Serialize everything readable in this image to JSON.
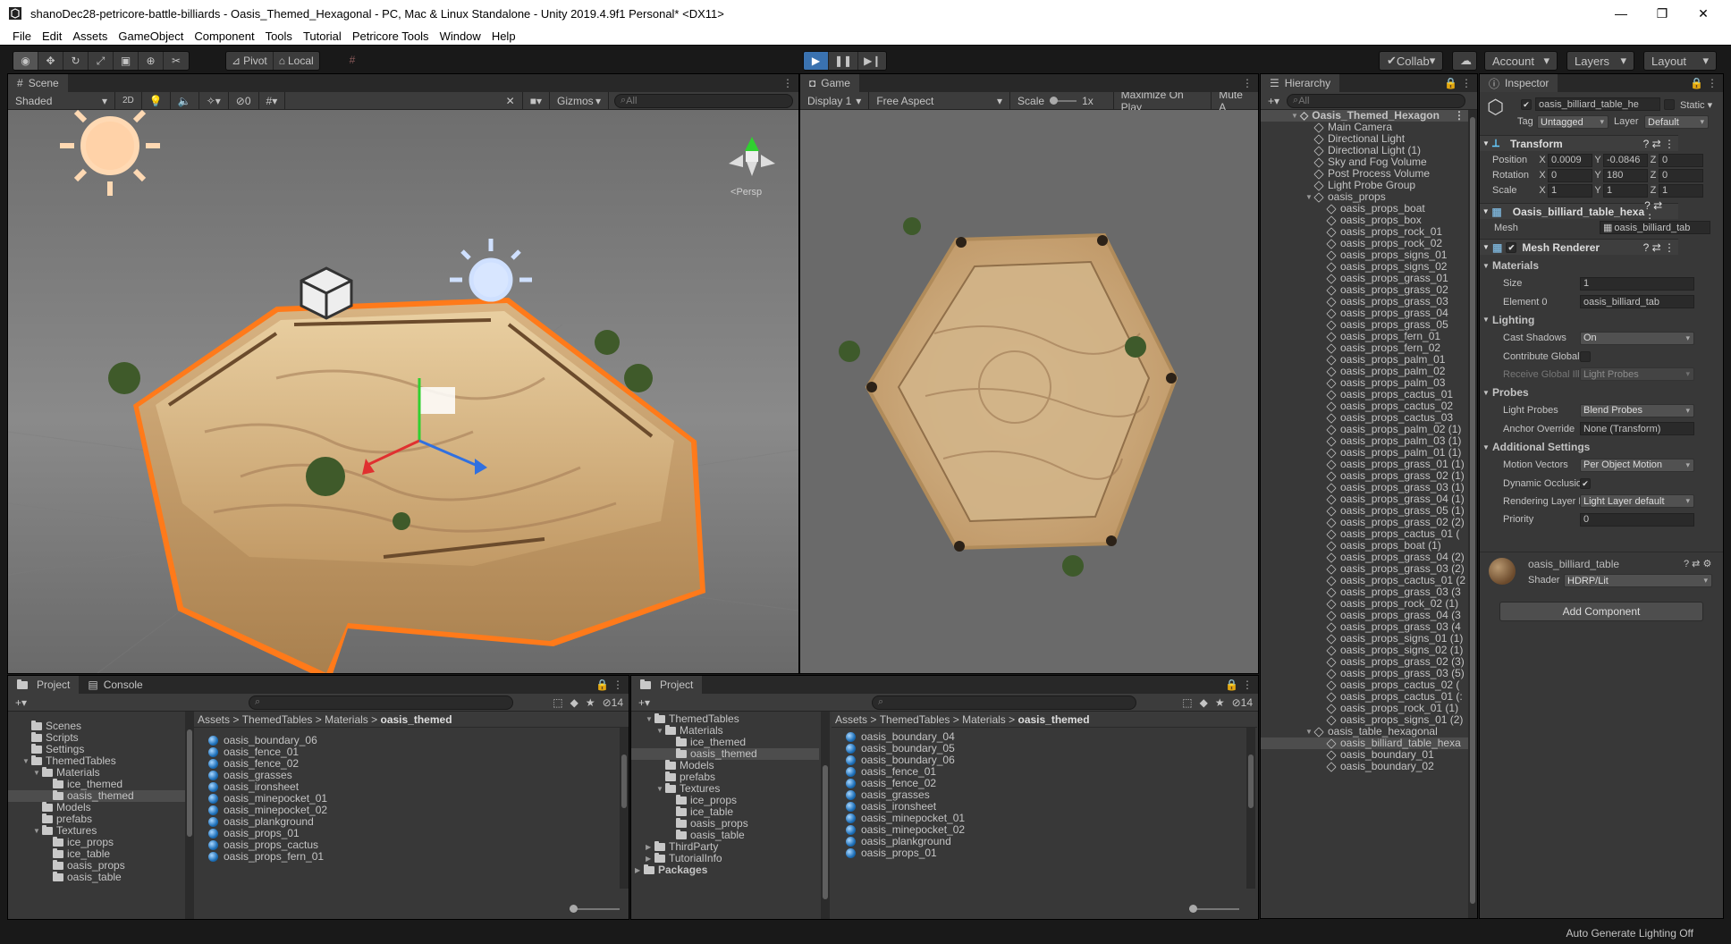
{
  "title": {
    "text": "shanoDec28-petricore-battle-billiards - Oasis_Themed_Hexagonal - PC, Mac & Linux Standalone - Unity 2019.4.9f1 Personal* <DX11>"
  },
  "menu": [
    "File",
    "Edit",
    "Assets",
    "GameObject",
    "Component",
    "Tools",
    "Tutorial",
    "Petricore Tools",
    "Window",
    "Help"
  ],
  "toolbar": {
    "pivot": "Pivot",
    "local": "Local",
    "collab": "Collab",
    "account": "Account",
    "layers": "Layers",
    "layout": "Layout"
  },
  "scene": {
    "tab": "Scene",
    "shading": "Shaded",
    "mode2d": "2D",
    "hidden_count": "0",
    "gizmos": "Gizmos",
    "search_placeholder": "All",
    "persp": "Persp",
    "persp_prefix": "<"
  },
  "game": {
    "tab": "Game",
    "display": "Display 1",
    "aspect": "Free Aspect",
    "scale_label": "Scale",
    "scale_value": "1x",
    "maximize": "Maximize On Play",
    "mute": "Mute A"
  },
  "hierarchy": {
    "tab": "Hierarchy",
    "search_placeholder": "All",
    "root": "Oasis_Themed_Hexagon",
    "items": [
      "Main Camera",
      "Directional Light",
      "Directional Light (1)",
      "Sky and Fog Volume",
      "Post Process Volume",
      "Light Probe Group",
      "oasis_props"
    ],
    "props": [
      "oasis_props_boat",
      "oasis_props_box",
      "oasis_props_rock_01",
      "oasis_props_rock_02",
      "oasis_props_signs_01",
      "oasis_props_signs_02",
      "oasis_props_grass_01",
      "oasis_props_grass_02",
      "oasis_props_grass_03",
      "oasis_props_grass_04",
      "oasis_props_grass_05",
      "oasis_props_fern_01",
      "oasis_props_fern_02",
      "oasis_props_palm_01",
      "oasis_props_palm_02",
      "oasis_props_palm_03",
      "oasis_props_cactus_01",
      "oasis_props_cactus_02",
      "oasis_props_cactus_03",
      "oasis_props_palm_02 (1)",
      "oasis_props_palm_03 (1)",
      "oasis_props_palm_01 (1)",
      "oasis_props_grass_01 (1)",
      "oasis_props_grass_02 (1)",
      "oasis_props_grass_03 (1)",
      "oasis_props_grass_04 (1)",
      "oasis_props_grass_05 (1)",
      "oasis_props_grass_02 (2)",
      "oasis_props_cactus_01 (",
      "oasis_props_boat (1)",
      "oasis_props_grass_04 (2)",
      "oasis_props_grass_03 (2)",
      "oasis_props_cactus_01 (2",
      "oasis_props_grass_03 (3",
      "oasis_props_rock_02 (1)",
      "oasis_props_grass_04 (3",
      "oasis_props_grass_03 (4",
      "oasis_props_signs_01 (1)",
      "oasis_props_signs_02 (1)",
      "oasis_props_grass_02 (3)",
      "oasis_props_grass_03 (5)",
      "oasis_props_cactus_02 (",
      "oasis_props_cactus_01 (:",
      "oasis_props_rock_01 (1)",
      "oasis_props_signs_01 (2)"
    ],
    "table_group": "oasis_table_hexagonal",
    "table_items": [
      "oasis_billiard_table_hexa",
      "oasis_boundary_01",
      "oasis_boundary_02"
    ]
  },
  "inspector": {
    "tab": "Inspector",
    "object_name": "oasis_billiard_table_he",
    "static": "Static",
    "tag_label": "Tag",
    "tag": "Untagged",
    "layer_label": "Layer",
    "layer": "Default",
    "transform": {
      "title": "Transform",
      "pos_label": "Position",
      "rot_label": "Rotation",
      "scale_label": "Scale",
      "px": "0.0009",
      "py": "-0.0846",
      "pz": "0",
      "rx": "0",
      "ry": "180",
      "rz": "0",
      "sx": "1",
      "sy": "1",
      "sz": "1"
    },
    "meshfilter": {
      "title": "Oasis_billiard_table_hexa",
      "mesh_label": "Mesh",
      "mesh": "oasis_billiard_tab"
    },
    "renderer": {
      "title": "Mesh Renderer",
      "materials": "Materials",
      "size_label": "Size",
      "size": "1",
      "el0_label": "Element 0",
      "el0": "oasis_billiard_tab",
      "lighting": "Lighting",
      "cast_label": "Cast Shadows",
      "cast": "On",
      "contrib_label": "Contribute Global I",
      "receive_label": "Receive Global Illu",
      "receive": "Light Probes",
      "probes": "Probes",
      "lp_label": "Light Probes",
      "lp": "Blend Probes",
      "anchor_label": "Anchor Override",
      "anchor": "None (Transform)",
      "additional": "Additional Settings",
      "mv_label": "Motion Vectors",
      "mv": "Per Object Motion",
      "dyn_label": "Dynamic Occlusio",
      "rl_label": "Rendering Layer M",
      "rl": "Light Layer default",
      "prio_label": "Priority",
      "prio": "0"
    },
    "material": {
      "name": "oasis_billiard_table",
      "shader_label": "Shader",
      "shader": "HDRP/Lit"
    },
    "add_component": "Add Component",
    "xyz": [
      "X",
      "Y",
      "Z"
    ]
  },
  "project_left": {
    "tab": "Project",
    "console_tab": "Console",
    "count": "14",
    "crumbs": [
      "Assets",
      "ThemedTables",
      "Materials"
    ],
    "crumb_last": "oasis_themed",
    "tree": [
      {
        "label": "Scenes",
        "indent": 1,
        "fold": ""
      },
      {
        "label": "Scripts",
        "indent": 1,
        "fold": ""
      },
      {
        "label": "Settings",
        "indent": 1,
        "fold": ""
      },
      {
        "label": "ThemedTables",
        "indent": 1,
        "fold": "▼"
      },
      {
        "label": "Materials",
        "indent": 2,
        "fold": "▼"
      },
      {
        "label": "ice_themed",
        "indent": 3,
        "fold": ""
      },
      {
        "label": "oasis_themed",
        "indent": 3,
        "fold": "",
        "sel": true
      },
      {
        "label": "Models",
        "indent": 2,
        "fold": ""
      },
      {
        "label": "prefabs",
        "indent": 2,
        "fold": ""
      },
      {
        "label": "Textures",
        "indent": 2,
        "fold": "▼"
      },
      {
        "label": "ice_props",
        "indent": 3,
        "fold": ""
      },
      {
        "label": "ice_table",
        "indent": 3,
        "fold": ""
      },
      {
        "label": "oasis_props",
        "indent": 3,
        "fold": ""
      },
      {
        "label": "oasis_table",
        "indent": 3,
        "fold": ""
      }
    ],
    "files": [
      "oasis_boundary_06",
      "oasis_fence_01",
      "oasis_fence_02",
      "oasis_grasses",
      "oasis_ironsheet",
      "oasis_minepocket_01",
      "oasis_minepocket_02",
      "oasis_plankground",
      "oasis_props_01",
      "oasis_props_cactus",
      "oasis_props_fern_01"
    ]
  },
  "project_right": {
    "tab": "Project",
    "count": "14",
    "crumbs": [
      "Assets",
      "ThemedTables",
      "Materials"
    ],
    "crumb_last": "oasis_themed",
    "tree": [
      {
        "label": "ThemedTables",
        "indent": 1,
        "fold": "▼"
      },
      {
        "label": "Materials",
        "indent": 2,
        "fold": "▼"
      },
      {
        "label": "ice_themed",
        "indent": 3,
        "fold": ""
      },
      {
        "label": "oasis_themed",
        "indent": 3,
        "fold": "",
        "sel": true
      },
      {
        "label": "Models",
        "indent": 2,
        "fold": ""
      },
      {
        "label": "prefabs",
        "indent": 2,
        "fold": ""
      },
      {
        "label": "Textures",
        "indent": 2,
        "fold": "▼"
      },
      {
        "label": "ice_props",
        "indent": 3,
        "fold": ""
      },
      {
        "label": "ice_table",
        "indent": 3,
        "fold": ""
      },
      {
        "label": "oasis_props",
        "indent": 3,
        "fold": ""
      },
      {
        "label": "oasis_table",
        "indent": 3,
        "fold": ""
      },
      {
        "label": "ThirdParty",
        "indent": 1,
        "fold": "▶"
      },
      {
        "label": "TutorialInfo",
        "indent": 1,
        "fold": "▶"
      },
      {
        "label": "Packages",
        "indent": 0,
        "fold": "▶",
        "bold": true
      }
    ],
    "files": [
      "oasis_boundary_04",
      "oasis_boundary_05",
      "oasis_boundary_06",
      "oasis_fence_01",
      "oasis_fence_02",
      "oasis_grasses",
      "oasis_ironsheet",
      "oasis_minepocket_01",
      "oasis_minepocket_02",
      "oasis_plankground",
      "oasis_props_01"
    ]
  },
  "status": {
    "lighting": "Auto Generate Lighting Off"
  },
  "colors": {
    "accent": "#2c5d87",
    "orange_outline": "#ff7a1a",
    "sand": "#d9b98a",
    "sky": "#6f6f6f"
  }
}
